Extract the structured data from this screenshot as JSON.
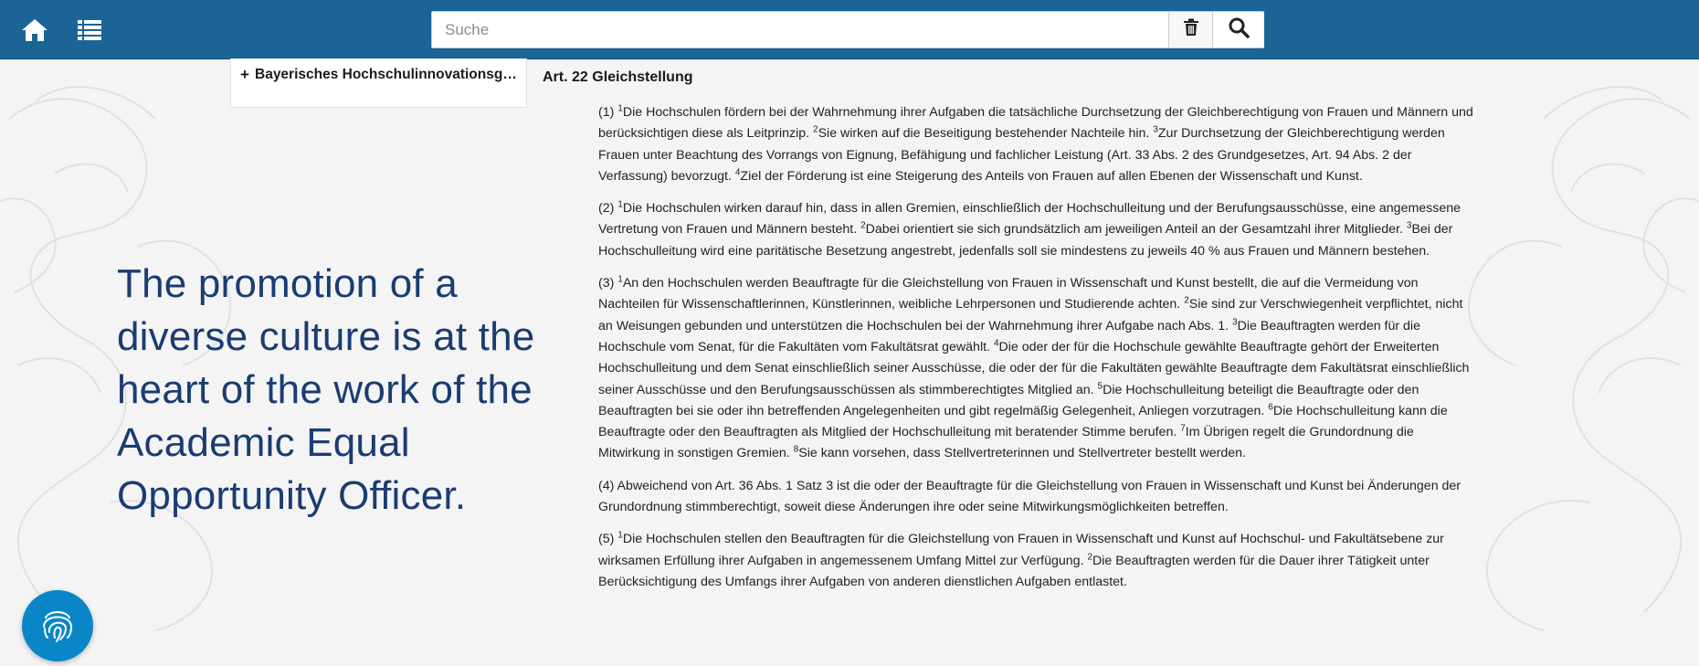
{
  "header": {
    "search_placeholder": "Suche",
    "icons": {
      "home": "home-icon",
      "toc": "list-icon",
      "clear": "trash-icon",
      "search": "search-icon"
    }
  },
  "toc": {
    "item_label": "Bayerisches Hochschulinnovationsgesetz",
    "expand_symbol": "+"
  },
  "overlay": {
    "quote": "The promotion of a diverse culture is at the heart of the work of the Academic Equal Opportunity Officer."
  },
  "article": {
    "title": "Art. 22  Gleichstellung",
    "paragraphs": [
      [
        {
          "t": "(1) "
        },
        {
          "s": "1"
        },
        {
          "t": "Die Hochschulen fördern bei der Wahrnehmung ihrer Aufgaben die tatsächliche Durchsetzung der Gleichberechtigung von Frauen und Männern und berücksichtigen diese als Leitprinzip. "
        },
        {
          "s": "2"
        },
        {
          "t": "Sie wirken auf die Beseitigung bestehender Nachteile hin. "
        },
        {
          "s": "3"
        },
        {
          "t": "Zur Durchsetzung der Gleichberechtigung werden Frauen unter Beachtung des Vorrangs von Eignung, Befähigung und fachlicher Leistung (Art. 33 Abs. 2 des Grundgesetzes, Art. 94 Abs. 2 der Verfassung) bevorzugt. "
        },
        {
          "s": "4"
        },
        {
          "t": "Ziel der Förderung ist eine Steigerung des Anteils von Frauen auf allen Ebenen der Wissenschaft und Kunst."
        }
      ],
      [
        {
          "t": "(2) "
        },
        {
          "s": "1"
        },
        {
          "t": "Die Hochschulen wirken darauf hin, dass in allen Gremien, einschließlich der Hochschulleitung und der Berufungsausschüsse, eine angemessene Vertretung von Frauen und Männern besteht. "
        },
        {
          "s": "2"
        },
        {
          "t": "Dabei orientiert sie sich grundsätzlich am jeweiligen Anteil an der Gesamtzahl ihrer Mitglieder. "
        },
        {
          "s": "3"
        },
        {
          "t": "Bei der Hochschulleitung wird eine paritätische Besetzung angestrebt, jedenfalls soll sie mindestens zu jeweils 40 % aus Frauen und Männern bestehen."
        }
      ],
      [
        {
          "t": "(3) "
        },
        {
          "s": "1"
        },
        {
          "t": "An den Hochschulen werden Beauftragte für die Gleichstellung von Frauen in Wissenschaft und Kunst bestellt, die auf die Vermeidung von Nachteilen für Wissenschaftlerinnen, Künstlerinnen, weibliche Lehrpersonen und Studierende achten. "
        },
        {
          "s": "2"
        },
        {
          "t": "Sie sind zur Verschwiegenheit verpflichtet, nicht an Weisungen gebunden und unterstützen die Hochschulen bei der Wahrnehmung ihrer Aufgabe nach Abs. 1. "
        },
        {
          "s": "3"
        },
        {
          "t": "Die Beauftragten werden für die Hochschule vom Senat, für die Fakultäten vom Fakultätsrat gewählt. "
        },
        {
          "s": "4"
        },
        {
          "t": "Die oder der für die Hochschule gewählte Beauftragte gehört der Erweiterten Hochschulleitung und dem Senat einschließlich seiner Ausschüsse, die oder der für die Fakultäten gewählte Beauftragte dem Fakultätsrat einschließlich seiner Ausschüsse und den Berufungsausschüssen als stimmberechtigtes Mitglied an. "
        },
        {
          "s": "5"
        },
        {
          "t": "Die Hochschulleitung beteiligt die Beauftragte oder den Beauftragten bei sie oder ihn betreffenden Angelegenheiten und gibt regelmäßig Gelegenheit, Anliegen vorzutragen. "
        },
        {
          "s": "6"
        },
        {
          "t": "Die Hochschulleitung kann die Beauftragte oder den Beauftragten als Mitglied der Hochschulleitung mit beratender Stimme berufen. "
        },
        {
          "s": "7"
        },
        {
          "t": "Im Übrigen regelt die Grundordnung die Mitwirkung in sonstigen Gremien. "
        },
        {
          "s": "8"
        },
        {
          "t": "Sie kann vorsehen, dass Stellvertreterinnen und Stellvertreter bestellt werden."
        }
      ],
      [
        {
          "t": "(4) Abweichend von Art. 36 Abs. 1 Satz 3 ist die oder der Beauftragte für die Gleichstellung von Frauen in Wissenschaft und Kunst bei Änderungen der Grundordnung stimmberechtigt, soweit diese Änderungen ihre oder seine Mitwirkungsmöglichkeiten betreffen."
        }
      ],
      [
        {
          "t": "(5) "
        },
        {
          "s": "1"
        },
        {
          "t": "Die Hochschulen stellen den Beauftragten für die Gleichstellung von Frauen in Wissenschaft und Kunst auf Hochschul- und Fakultätsebene zur wirksamen Erfüllung ihrer Aufgaben in angemessenem Umfang Mittel zur Verfügung. "
        },
        {
          "s": "2"
        },
        {
          "t": "Die Beauftragten werden für die Dauer ihrer Tätigkeit unter Berücksichtigung des Umfangs ihrer Aufgaben von anderen dienstlichen Aufgaben entlastet."
        }
      ]
    ]
  },
  "floating_button": {
    "icon": "fingerprint-icon"
  },
  "colors": {
    "header_bg": "#1a6496",
    "quote_text": "#1a3c72",
    "fab_bg": "#0a86c8"
  }
}
